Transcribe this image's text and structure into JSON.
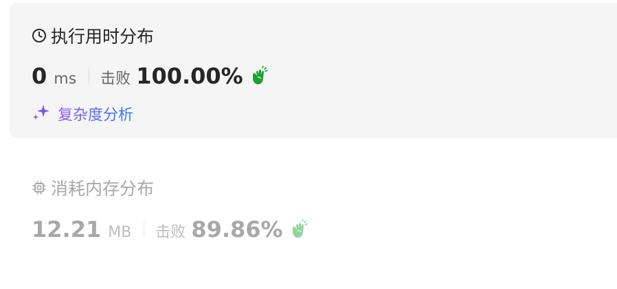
{
  "runtime": {
    "title": "执行用时分布",
    "title_icon": "clock-icon",
    "value": "0",
    "unit": "ms",
    "beat_label": "击败",
    "beat_percent": "100.00%",
    "clap_icon": "clapping-hands-icon",
    "clap_color": "#1aa22a"
  },
  "analysis": {
    "icon": "sparkle-icon",
    "label": "复杂度分析"
  },
  "memory": {
    "title": "消耗内存分布",
    "title_icon": "chip-icon",
    "value": "12.21",
    "unit": "MB",
    "beat_label": "击败",
    "beat_percent": "89.86%",
    "clap_icon": "clapping-hands-icon",
    "clap_color": "#8fd69a"
  }
}
